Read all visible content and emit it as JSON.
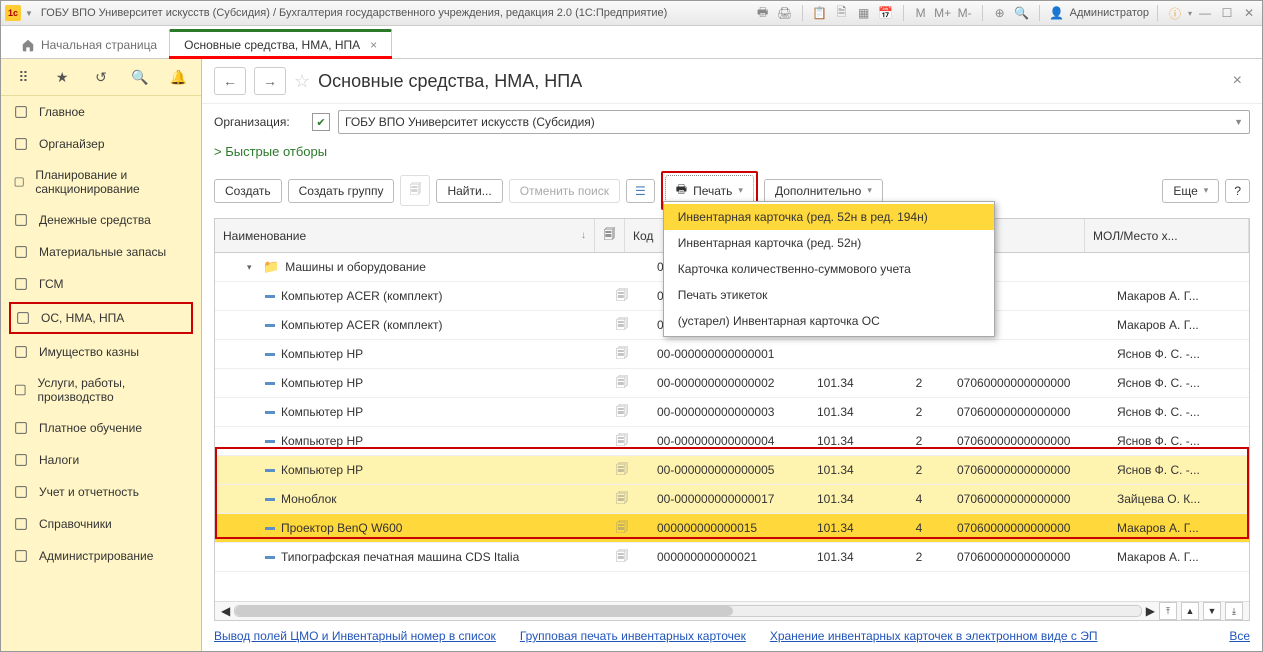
{
  "titlebar": {
    "title": "ГОБУ ВПО Университет искусств (Субсидия) / Бухгалтерия государственного учреждения, редакция 2.0  (1С:Предприятие)",
    "user": "Администратор",
    "m_buttons": [
      "M",
      "M+",
      "M-"
    ]
  },
  "tabs": {
    "home": "Начальная страница",
    "active": "Основные средства, НМА, НПА"
  },
  "sidebar": {
    "items": [
      {
        "label": "Главное"
      },
      {
        "label": "Органайзер"
      },
      {
        "label": "Планирование и санкционирование"
      },
      {
        "label": "Денежные средства"
      },
      {
        "label": "Материальные запасы"
      },
      {
        "label": "ГСМ"
      },
      {
        "label": "ОС, НМА, НПА",
        "boxed": true
      },
      {
        "label": "Имущество казны"
      },
      {
        "label": "Услуги, работы, производство"
      },
      {
        "label": "Платное обучение"
      },
      {
        "label": "Налоги"
      },
      {
        "label": "Учет и отчетность"
      },
      {
        "label": "Справочники"
      },
      {
        "label": "Администрирование"
      }
    ]
  },
  "page": {
    "title": "Основные средства, НМА, НПА",
    "org_label": "Организация:",
    "org_value": "ГОБУ ВПО Университет искусств (Субсидия)",
    "filters": "Быстрые отборы"
  },
  "toolbar": {
    "create": "Создать",
    "create_group": "Создать группу",
    "find": "Найти...",
    "cancel_search": "Отменить поиск",
    "print": "Печать",
    "more_actions": "Дополнительно",
    "more": "Еще",
    "help": "?"
  },
  "print_menu": [
    "Инвентарная карточка (ред. 52н в ред. 194н)",
    "Инвентарная карточка (ред. 52н)",
    "Карточка количественно-суммового учета",
    "Печать этикеток",
    "(устарел) Инвентарная карточка ОС"
  ],
  "columns": {
    "name": "Наименование",
    "code": "Код",
    "mol": "МОЛ/Место х..."
  },
  "rows": [
    {
      "type": "group",
      "indent": 1,
      "name": "Машины и оборудование",
      "code": "000000000000010"
    },
    {
      "type": "item",
      "indent": 2,
      "name": "Компьютер ACER (комплект)",
      "code": "000000000000001",
      "mol": "Макаров А. Г..."
    },
    {
      "type": "item",
      "indent": 2,
      "name": "Компьютер ACER (комплект)",
      "code": "000000000000002",
      "mol": "Макаров А. Г..."
    },
    {
      "type": "item",
      "indent": 2,
      "name": "Компьютер HP",
      "code": "00-000000000000001",
      "mol": "Яснов Ф. С. -..."
    },
    {
      "type": "item",
      "indent": 2,
      "name": "Компьютер HP",
      "code": "00-000000000000002",
      "cls": "101.34",
      "qty": "2",
      "inv": "07060000000000000",
      "mol": "Яснов Ф. С. -..."
    },
    {
      "type": "item",
      "indent": 2,
      "name": "Компьютер HP",
      "code": "00-000000000000003",
      "cls": "101.34",
      "qty": "2",
      "inv": "07060000000000000",
      "mol": "Яснов Ф. С. -..."
    },
    {
      "type": "item",
      "indent": 2,
      "name": "Компьютер HP",
      "code": "00-000000000000004",
      "cls": "101.34",
      "qty": "2",
      "inv": "07060000000000000",
      "mol": "Яснов Ф. С. -..."
    },
    {
      "type": "item",
      "indent": 2,
      "name": "Компьютер HP",
      "code": "00-000000000000005",
      "cls": "101.34",
      "qty": "2",
      "inv": "07060000000000000",
      "mol": "Яснов Ф. С. -...",
      "selected": true
    },
    {
      "type": "item",
      "indent": 2,
      "name": "Моноблок",
      "code": "00-000000000000017",
      "cls": "101.34",
      "qty": "4",
      "inv": "07060000000000000",
      "mol": "Зайцева О. К...",
      "selected": true
    },
    {
      "type": "item",
      "indent": 2,
      "name": "Проектор BenQ W600",
      "code": "000000000000015",
      "cls": "101.34",
      "qty": "4",
      "inv": "07060000000000000",
      "mol": "Макаров А. Г...",
      "selected": true,
      "hl": true
    },
    {
      "type": "item",
      "indent": 2,
      "name": "Типографская печатная машина CDS Italia",
      "code": "000000000000021",
      "cls": "101.34",
      "qty": "2",
      "inv": "07060000000000000",
      "mol": "Макаров А. Г..."
    }
  ],
  "footer": {
    "link1": "Вывод полей ЦМО и Инвентарный номер в список",
    "link2": "Групповая печать инвентарных карточек",
    "link3": "Хранение инвентарных карточек в электронном виде с ЭП",
    "all": "Все"
  }
}
